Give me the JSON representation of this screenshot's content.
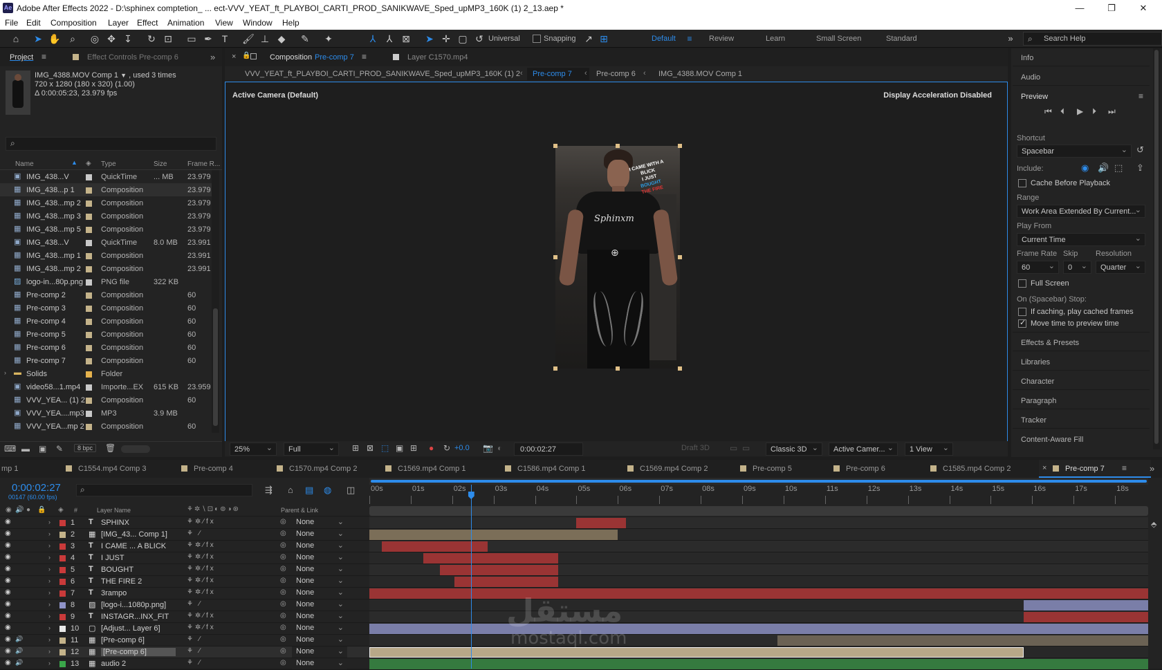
{
  "window": {
    "title": "Adobe After Effects 2022 - D:\\sphinex comptetion_ ... ect-VVV_YEAT_ft_PLAYBOI_CARTI_PROD_SANIKWAVE_Sped_upMP3_160K (1) 2_13.aep *",
    "app_badge": "Ae"
  },
  "menu": [
    "File",
    "Edit",
    "Composition",
    "Layer",
    "Effect",
    "Animation",
    "View",
    "Window",
    "Help"
  ],
  "toolbar": {
    "universal_label": "Universal",
    "snapping_label": "Snapping",
    "workspaces": [
      "Default",
      "Review",
      "Learn",
      "Small Screen",
      "Standard"
    ],
    "search_placeholder": "Search Help"
  },
  "project_panel": {
    "tab_project": "Project",
    "tab_effect_controls": "Effect Controls",
    "tab_effect_controls_target": "Pre-comp 6",
    "selected_name": "IMG_4388.MOV Comp 1",
    "selected_used": ", used 3 times",
    "selected_dims": "720 x 1280  (180 x 320) (1.00)",
    "selected_duration": "Δ 0:00:05:23, 23.979 fps",
    "columns": {
      "name": "Name",
      "type": "Type",
      "size": "Size",
      "frame_rate": "Frame R..."
    },
    "items": [
      {
        "name": "IMG_438...V",
        "type": "QuickTime",
        "size": "... MB",
        "fps": "23.979",
        "icon": "film",
        "color": "#c9c9c9"
      },
      {
        "name": "IMG_438...p 1",
        "type": "Composition",
        "size": "",
        "fps": "23.979",
        "icon": "comp",
        "color": "#c4b38a",
        "selected": true
      },
      {
        "name": "IMG_438...mp 2",
        "type": "Composition",
        "size": "",
        "fps": "23.979",
        "icon": "comp",
        "color": "#c4b38a"
      },
      {
        "name": "IMG_438...mp 3",
        "type": "Composition",
        "size": "",
        "fps": "23.979",
        "icon": "comp",
        "color": "#c4b38a"
      },
      {
        "name": "IMG_438...mp 5",
        "type": "Composition",
        "size": "",
        "fps": "23.979",
        "icon": "comp",
        "color": "#c4b38a"
      },
      {
        "name": "IMG_438...V",
        "type": "QuickTime",
        "size": "8.0 MB",
        "fps": "23.991",
        "icon": "film",
        "color": "#c9c9c9"
      },
      {
        "name": "IMG_438...mp 1",
        "type": "Composition",
        "size": "",
        "fps": "23.991",
        "icon": "comp",
        "color": "#c4b38a"
      },
      {
        "name": "IMG_438...mp 2",
        "type": "Composition",
        "size": "",
        "fps": "23.991",
        "icon": "comp",
        "color": "#c4b38a"
      },
      {
        "name": "logo-in...80p.png",
        "type": "PNG file",
        "size": "322 KB",
        "fps": "",
        "icon": "png",
        "color": "#c9c9c9"
      },
      {
        "name": "Pre-comp 2",
        "type": "Composition",
        "size": "",
        "fps": "60",
        "icon": "comp",
        "color": "#c4b38a"
      },
      {
        "name": "Pre-comp 3",
        "type": "Composition",
        "size": "",
        "fps": "60",
        "icon": "comp",
        "color": "#c4b38a"
      },
      {
        "name": "Pre-comp 4",
        "type": "Composition",
        "size": "",
        "fps": "60",
        "icon": "comp",
        "color": "#c4b38a"
      },
      {
        "name": "Pre-comp 5",
        "type": "Composition",
        "size": "",
        "fps": "60",
        "icon": "comp",
        "color": "#c4b38a"
      },
      {
        "name": "Pre-comp 6",
        "type": "Composition",
        "size": "",
        "fps": "60",
        "icon": "comp",
        "color": "#c4b38a"
      },
      {
        "name": "Pre-comp 7",
        "type": "Composition",
        "size": "",
        "fps": "60",
        "icon": "comp",
        "color": "#c4b38a"
      },
      {
        "name": "Solids",
        "type": "Folder",
        "size": "",
        "fps": "",
        "icon": "folder",
        "color": "#e5b24d"
      },
      {
        "name": "video58...1.mp4",
        "type": "Importe...EX",
        "size": "615 KB",
        "fps": "23.959",
        "icon": "film",
        "color": "#c9c9c9"
      },
      {
        "name": "VVV_YEA... (1) 2",
        "type": "Composition",
        "size": "",
        "fps": "60",
        "icon": "comp",
        "color": "#c4b38a"
      },
      {
        "name": "VVV_YEA....mp3",
        "type": "MP3",
        "size": "3.9 MB",
        "fps": "",
        "icon": "film",
        "color": "#c9c9c9"
      },
      {
        "name": "VVV_YEA...mp 2",
        "type": "Composition",
        "size": "",
        "fps": "60",
        "icon": "comp",
        "color": "#c4b38a"
      }
    ],
    "bpc": "8 bpc"
  },
  "comp_panel": {
    "tab_comp_prefix": "Composition",
    "tab_comp_name": "Pre-comp 7",
    "tab_layer": "Layer C1570.mp4",
    "breadcrumbs": [
      "VVV_YEAT_ft_PLAYBOI_CARTI_PROD_SANIKWAVE_Sped_upMP3_160K (1) 2",
      "Pre-comp 7",
      "Pre-comp 6",
      "IMG_4388.MOV Comp 1"
    ],
    "active_camera": "Active Camera (Default)",
    "accel_notice": "Display Acceleration Disabled",
    "overlay_lines": [
      "I CAME WITH A BLICK",
      "I JUST",
      "BOUGHT",
      "THE FIRE"
    ],
    "shirt_text": "Sphinxm",
    "zoom": "25%",
    "resolution": "Full",
    "exposure": "+0.0",
    "timecode": "0:00:02:27",
    "draft": "Draft 3D",
    "renderer": "Classic 3D",
    "camera": "Active Camer...",
    "views": "1 View"
  },
  "right_panel": {
    "info": "Info",
    "audio": "Audio",
    "preview": "Preview",
    "shortcut_label": "Shortcut",
    "shortcut_value": "Spacebar",
    "include_label": "Include:",
    "cache_label": "Cache Before Playback",
    "range_label": "Range",
    "range_value": "Work Area Extended By Current...",
    "play_from_label": "Play From",
    "play_from_value": "Current Time",
    "frame_rate_label": "Frame Rate",
    "skip_label": "Skip",
    "resolution_label": "Resolution",
    "frame_rate_value": "60",
    "skip_value": "0",
    "resolution_value": "Quarter",
    "full_screen_label": "Full Screen",
    "stop_label": "On (Spacebar) Stop:",
    "if_caching_label": "If caching, play cached frames",
    "move_time_label": "Move time to preview time",
    "sections": [
      "Effects & Presets",
      "Libraries",
      "Character",
      "Paragraph",
      "Tracker",
      "Content-Aware Fill"
    ]
  },
  "timeline": {
    "tabs": [
      {
        "label": "mp 1",
        "color": ""
      },
      {
        "label": "C1554.mp4 Comp 3",
        "color": "#c4b38a"
      },
      {
        "label": "Pre-comp 4",
        "color": "#c4b38a"
      },
      {
        "label": "C1570.mp4 Comp 2",
        "color": "#c4b38a"
      },
      {
        "label": "C1569.mp4 Comp 1",
        "color": "#c4b38a"
      },
      {
        "label": "C1586.mp4 Comp 1",
        "color": "#c4b38a"
      },
      {
        "label": "C1569.mp4 Comp 2",
        "color": "#c4b38a"
      },
      {
        "label": "Pre-comp 5",
        "color": "#c4b38a"
      },
      {
        "label": "Pre-comp 6",
        "color": "#c4b38a"
      },
      {
        "label": "C1585.mp4 Comp 2",
        "color": "#c4b38a"
      },
      {
        "label": "Pre-comp 7",
        "color": "#c4b38a",
        "active": true
      }
    ],
    "current_time": "0:00:02:27",
    "frame_info": "00147 (60.00 fps)",
    "columns": {
      "num": "#",
      "layer_name": "Layer Name",
      "parent": "Parent & Link"
    },
    "ruler": [
      "00s",
      "01s",
      "02s",
      "03s",
      "04s",
      "05s",
      "06s",
      "07s",
      "08s",
      "09s",
      "10s",
      "11s",
      "12s",
      "13s",
      "14s",
      "15s",
      "16s",
      "17s",
      "18s"
    ],
    "playhead_seconds": 2.45,
    "duration_seconds": 18.8,
    "layers": [
      {
        "num": "1",
        "type": "T",
        "name": "SPHINX",
        "color": "#c93a3a",
        "parent": "None",
        "in": 5.0,
        "out": 6.2,
        "bar": "#9a3434"
      },
      {
        "num": "2",
        "type": "C",
        "name": "[IMG_43... Comp 1]",
        "color": "#c4b38a",
        "parent": "None",
        "in": 0.0,
        "out": 6.0,
        "bar": "#7b6e58"
      },
      {
        "num": "3",
        "type": "T",
        "name": "I CAME ... A BLICK",
        "color": "#c93a3a",
        "parent": "None",
        "in": 0.3,
        "out": 2.85,
        "bar": "#9a3434"
      },
      {
        "num": "4",
        "type": "T",
        "name": "I JUST",
        "color": "#c93a3a",
        "parent": "None",
        "in": 1.3,
        "out": 4.55,
        "bar": "#9a3434"
      },
      {
        "num": "5",
        "type": "T",
        "name": "BOUGHT",
        "color": "#c93a3a",
        "parent": "None",
        "in": 1.7,
        "out": 4.55,
        "bar": "#9a3434"
      },
      {
        "num": "6",
        "type": "T",
        "name": "THE FIRE 2",
        "color": "#c93a3a",
        "parent": "None",
        "in": 2.05,
        "out": 4.55,
        "bar": "#9a3434"
      },
      {
        "num": "7",
        "type": "T",
        "name": "3rampo",
        "color": "#c93a3a",
        "parent": "None",
        "in": 0.0,
        "out": 18.8,
        "bar": "#9a3434"
      },
      {
        "num": "8",
        "type": "P",
        "name": "[logo-i...1080p.png]",
        "color": "#8f93c9",
        "parent": "None",
        "in": 15.8,
        "out": 18.8,
        "bar": "#7a7ea8"
      },
      {
        "num": "9",
        "type": "T",
        "name": "INSTAGR...INX_FIT",
        "color": "#c93a3a",
        "parent": "None",
        "in": 15.8,
        "out": 18.8,
        "bar": "#9a3434"
      },
      {
        "num": "10",
        "type": "A",
        "name": "[Adjust... Layer 6]",
        "color": "#e8e8e8",
        "parent": "None",
        "in": 0.0,
        "out": 18.8,
        "bar": "#7a7ea8"
      },
      {
        "num": "11",
        "type": "C",
        "name": "[Pre-comp 6]",
        "color": "#c4b38a",
        "parent": "None",
        "in": 9.85,
        "out": 18.8,
        "bar": "#6b6254"
      },
      {
        "num": "12",
        "type": "C",
        "name": "[Pre-comp 6]",
        "color": "#c4b38a",
        "parent": "None",
        "in": 0.0,
        "out": 15.8,
        "bar": "#b8a888",
        "selected": true
      },
      {
        "num": "13",
        "type": "C",
        "name": "audio 2",
        "color": "#3aa64a",
        "parent": "None",
        "in": 0.0,
        "out": 18.8,
        "bar": "#357a3f"
      }
    ]
  },
  "watermark": {
    "arabic": "مستقل",
    "latin": "mostaql.com"
  },
  "colors": {
    "accent": "#2d8ceb",
    "panel": "#232323",
    "bg": "#1d1d1d"
  }
}
